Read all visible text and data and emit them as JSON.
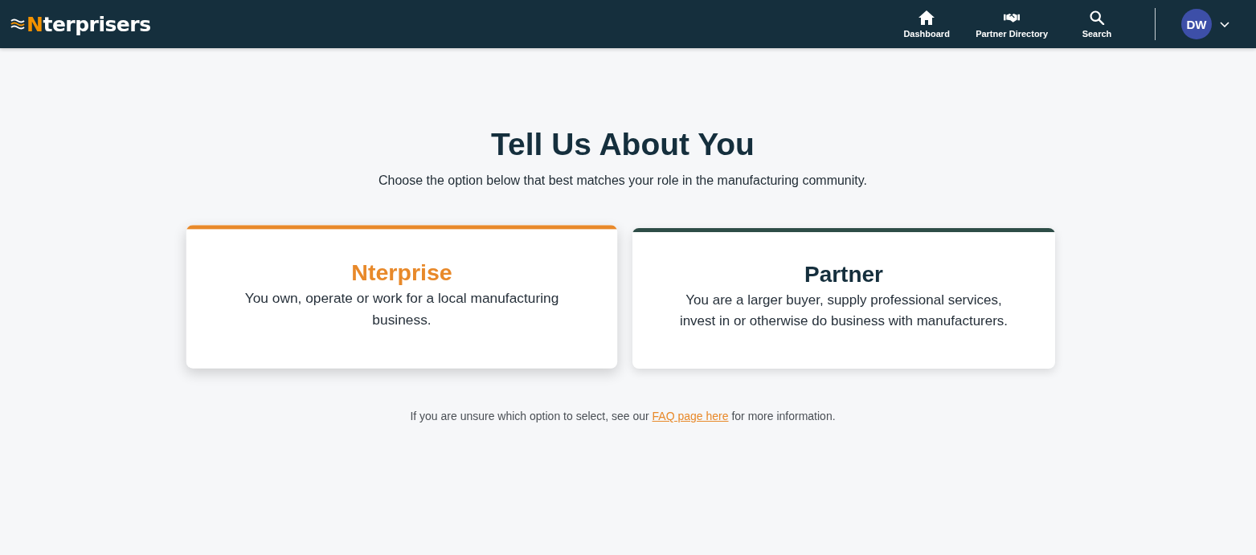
{
  "header": {
    "logo": {
      "accent": "N",
      "text": "terprisers"
    },
    "nav": [
      {
        "label": "Dashboard"
      },
      {
        "label": "Partner Directory"
      },
      {
        "label": "Search"
      }
    ],
    "user": {
      "initials": "DW"
    }
  },
  "page": {
    "title": "Tell Us About You",
    "subtitle": "Choose the option below that best matches your role in the manufacturing community.",
    "options": [
      {
        "title": "Nterprise",
        "description": "You own, operate or work for a local manufacturing business.",
        "color": "#e8892a",
        "selected": true
      },
      {
        "title": "Partner",
        "description": "You are a larger buyer, supply professional services, invest in or otherwise do business with manufacturers.",
        "color": "#2e4d47",
        "selected": false
      }
    ],
    "footnote": {
      "before": "If you are unsure which option to select, see our",
      "link": "FAQ page here",
      "after": "for more information."
    }
  }
}
